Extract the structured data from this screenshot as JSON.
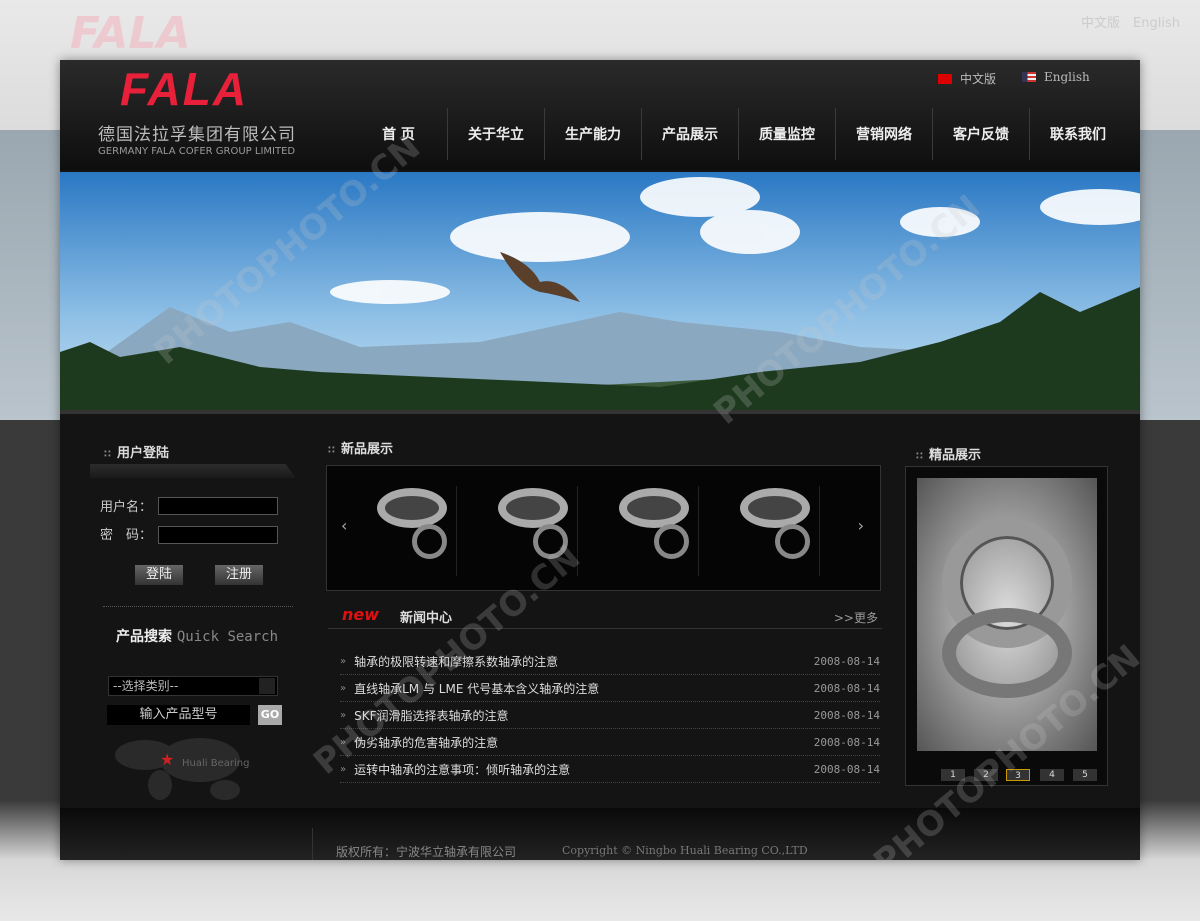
{
  "brand": {
    "logo": "FALA",
    "company_cn": "德国法拉孚集团有限公司",
    "company_en": "GERMANY FALA COFER GROUP LIMITED"
  },
  "lang": {
    "cn": "中文版",
    "en": "English"
  },
  "nav": [
    "首 页",
    "关于华立",
    "生产能力",
    "产品展示",
    "质量监控",
    "营销网络",
    "客户反馈",
    "联系我们"
  ],
  "login": {
    "title": "用户登陆",
    "username_label": "用户名：",
    "password_label": "密　码：",
    "login_btn": "登陆",
    "register_btn": "注册"
  },
  "search": {
    "title_cn": "产品搜索",
    "title_en": "Quick Search",
    "category_placeholder": "--选择类别--",
    "model_placeholder": "输入产品型号",
    "go": "GO",
    "map_label": "Huali Bearing"
  },
  "new_products": {
    "title": "新品展示"
  },
  "news": {
    "badge": "new",
    "title": "新闻中心",
    "more": ">>更多",
    "items": [
      {
        "title": "轴承的极限转速和摩擦系数轴承的注意",
        "date": "2008-08-14"
      },
      {
        "title": "直线轴承LM 与 LME 代号基本含义轴承的注意",
        "date": "2008-08-14"
      },
      {
        "title": "SKF润滑脂选择表轴承的注意",
        "date": "2008-08-14"
      },
      {
        "title": "伪劣轴承的危害轴承的注意",
        "date": "2008-08-14"
      },
      {
        "title": "运转中轴承的注意事项：倾听轴承的注意",
        "date": "2008-08-14"
      }
    ]
  },
  "featured": {
    "title": "精品展示",
    "pages": [
      "1",
      "2",
      "3",
      "4",
      "5"
    ],
    "active_page": "3"
  },
  "footer": {
    "copyright_cn": "版权所有：宁波华立轴承有限公司",
    "copyright_en": "Copyright © Ningbo Huali Bearing CO.,LTD"
  },
  "watermark": "PHOTOPHOTO.CN",
  "colors": {
    "brand_red": "#e8203a",
    "bg": "#141414"
  }
}
